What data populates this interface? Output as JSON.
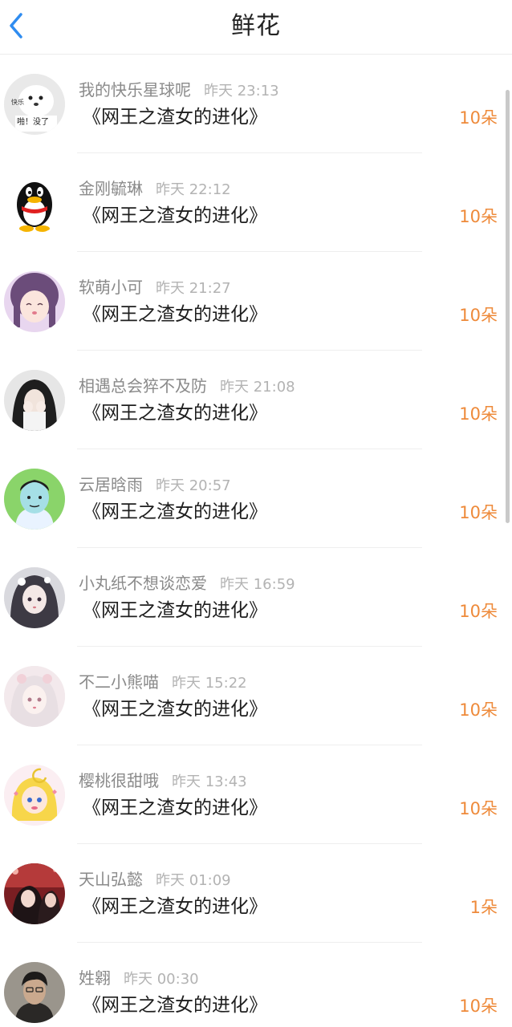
{
  "header": {
    "title": "鲜花",
    "back_icon": "chevron-left-icon"
  },
  "colors": {
    "accent": "#2f8cf0",
    "count": "#ee8a3a",
    "name": "#8a8a8a",
    "time": "#b3b3b3"
  },
  "list": [
    {
      "name": "我的快乐星球呢",
      "time": "昨天 23:13",
      "book": "《网王之渣女的进化》",
      "count": "10朵",
      "avatar_text_1": "快乐",
      "avatar_text_2": "啪！没了"
    },
    {
      "name": "金刚毓琳",
      "time": "昨天 22:12",
      "book": "《网王之渣女的进化》",
      "count": "10朵"
    },
    {
      "name": "软萌小可",
      "time": "昨天 21:27",
      "book": "《网王之渣女的进化》",
      "count": "10朵"
    },
    {
      "name": "相遇总会猝不及防",
      "time": "昨天 21:08",
      "book": "《网王之渣女的进化》",
      "count": "10朵"
    },
    {
      "name": "云居晗雨",
      "time": "昨天 20:57",
      "book": "《网王之渣女的进化》",
      "count": "10朵"
    },
    {
      "name": "小丸纸不想谈恋爱",
      "time": "昨天 16:59",
      "book": "《网王之渣女的进化》",
      "count": "10朵"
    },
    {
      "name": "不二小熊喵",
      "time": "昨天 15:22",
      "book": "《网王之渣女的进化》",
      "count": "10朵"
    },
    {
      "name": "樱桃很甜哦",
      "time": "昨天 13:43",
      "book": "《网王之渣女的进化》",
      "count": "10朵"
    },
    {
      "name": "天山弘懿",
      "time": "昨天 01:09",
      "book": "《网王之渣女的进化》",
      "count": "1朵"
    },
    {
      "name": "姓翱",
      "time": "昨天 00:30",
      "book": "《网王之渣女的进化》",
      "count": "10朵"
    }
  ]
}
